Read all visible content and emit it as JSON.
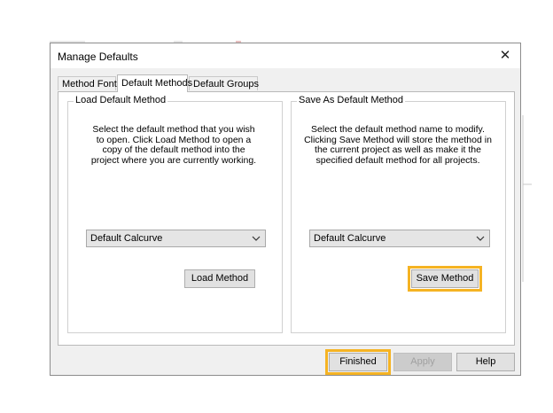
{
  "dialog": {
    "title": "Manage Defaults",
    "close_glyph": "✕"
  },
  "tabs": [
    {
      "label": "Method Fonts",
      "active": false
    },
    {
      "label": "Default Methods",
      "active": true
    },
    {
      "label": "Default Groups",
      "active": false
    }
  ],
  "load_group": {
    "legend": "Load Default Method",
    "description": "Select the default method that you wish to open.  Click Load Method to open a copy of the default method into the project where you are currently working.",
    "selected_method": "Default Calcurve",
    "button_label": "Load Method"
  },
  "save_group": {
    "legend": "Save As Default Method",
    "description": "Select the default method name to modify. Clicking Save Method will store the method in the current project as well as make it the specified default method for all projects.",
    "selected_method": "Default Calcurve",
    "button_label": "Save Method"
  },
  "footer": {
    "finished_label": "Finished",
    "apply_label": "Apply",
    "help_label": "Help"
  },
  "colors": {
    "highlight": "#f5b323",
    "dialog_bg": "#f0f0f0"
  },
  "icons": {
    "close": "close-icon",
    "dropdown": "chevron-down-icon"
  }
}
